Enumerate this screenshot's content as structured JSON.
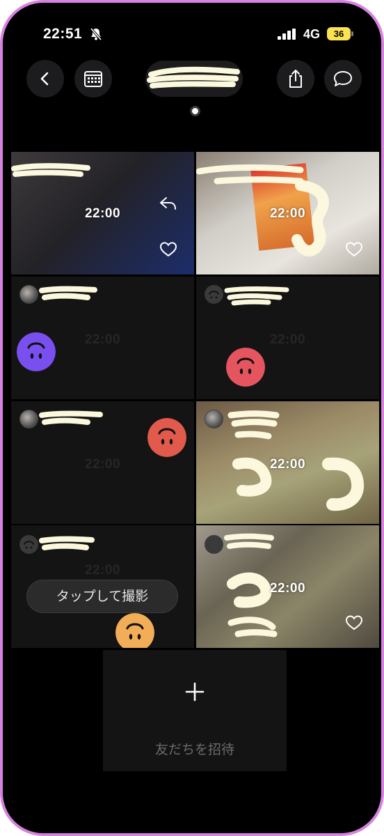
{
  "status_bar": {
    "time": "22:51",
    "network": "4G",
    "battery": "36"
  },
  "nav": {
    "back_icon": "chevron-left-icon",
    "calendar_icon": "calendar-icon",
    "share_icon": "share-icon",
    "chat_icon": "chat-bubble-icon"
  },
  "posts": [
    {
      "time": "22:00"
    },
    {
      "time": "22:00"
    },
    {
      "time": "22:00"
    },
    {
      "time": "22:00"
    },
    {
      "time": "22:00"
    },
    {
      "time": "22:00"
    },
    {
      "time": "22:00"
    },
    {
      "time": "22:00"
    }
  ],
  "tap_prompt": "タップして撮影",
  "invite": {
    "label": "友だちを招待"
  },
  "colors": {
    "frame": "#d782e0",
    "battery": "#fbe34f",
    "smiley_purple": "#7a4ff0",
    "smiley_red": "#e5555f",
    "smiley_orange": "#e15a4c",
    "smiley_yellow": "#f2ad58",
    "redaction": "#fbf8de"
  }
}
